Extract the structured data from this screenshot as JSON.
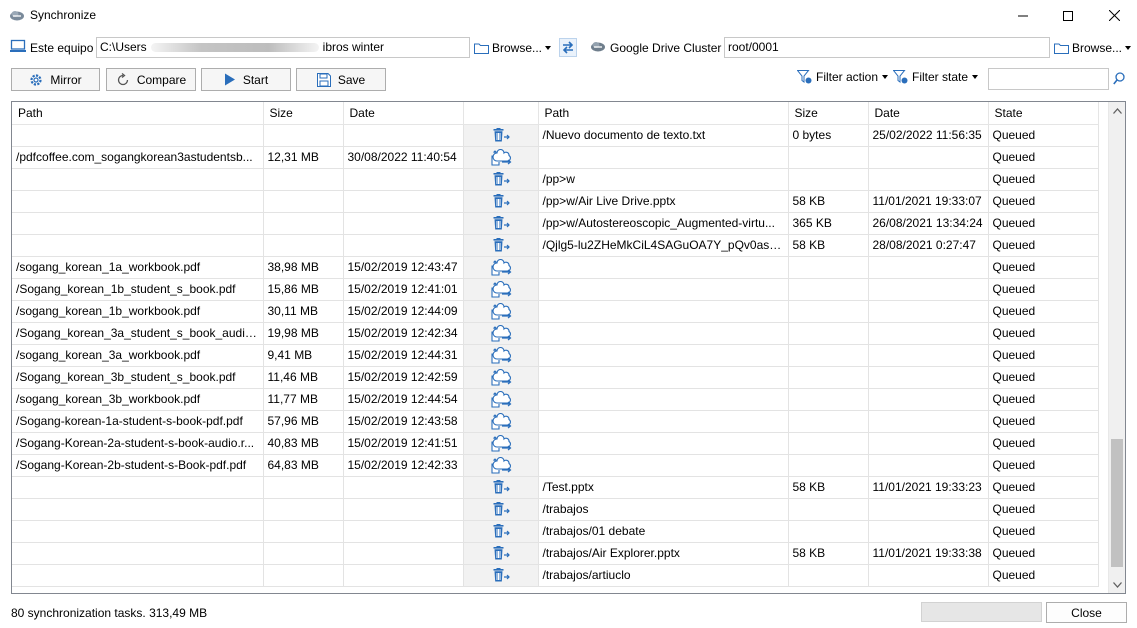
{
  "window": {
    "title": "Synchronize"
  },
  "left_location": {
    "label": "Este equipo",
    "path_start": "C:\\Users",
    "path_end": "ibros winter",
    "browse": "Browse..."
  },
  "right_location": {
    "label": "Google Drive Cluster",
    "path": "root/0001",
    "browse": "Browse..."
  },
  "toolbar": {
    "mirror": "Mirror",
    "compare": "Compare",
    "start": "Start",
    "save": "Save",
    "filter_action": "Filter action",
    "filter_state": "Filter state"
  },
  "columns": {
    "left_path": "Path",
    "left_size": "Size",
    "left_date": "Date",
    "right_path": "Path",
    "right_size": "Size",
    "right_date": "Date",
    "state": "State"
  },
  "rows": [
    {
      "lp": "",
      "ls": "",
      "ld": "",
      "act": "delete",
      "rp": "/Nuevo documento de texto.txt",
      "rs": "0 bytes",
      "rd": "25/02/2022 11:56:35",
      "st": "Queued"
    },
    {
      "lp": "/pdfcoffee.com_sogangkorean3astudentsb...",
      "ls": "12,31 MB",
      "ld": "30/08/2022 11:40:54",
      "act": "upload",
      "rp": "",
      "rs": "",
      "rd": "",
      "st": "Queued"
    },
    {
      "lp": "",
      "ls": "",
      "ld": "",
      "act": "delete",
      "rp": "/pp>w",
      "rs": "",
      "rd": "",
      "st": "Queued"
    },
    {
      "lp": "",
      "ls": "",
      "ld": "",
      "act": "delete",
      "rp": "/pp>w/Air Live Drive.pptx",
      "rs": "58 KB",
      "rd": "11/01/2021 19:33:07",
      "st": "Queued"
    },
    {
      "lp": "",
      "ls": "",
      "ld": "",
      "act": "delete",
      "rp": "/pp>w/Autostereoscopic_Augmented-virtu...",
      "rs": "365 KB",
      "rd": "26/08/2021 13:34:24",
      "st": "Queued"
    },
    {
      "lp": "",
      "ls": "",
      "ld": "",
      "act": "delete",
      "rp": "/Qjlg5-lu2ZHeMkCiL4SAGuOA7Y_pQv0asau...",
      "rs": "58 KB",
      "rd": "28/08/2021 0:27:47",
      "st": "Queued"
    },
    {
      "lp": "/sogang_korean_1a_workbook.pdf",
      "ls": "38,98 MB",
      "ld": "15/02/2019 12:43:47",
      "act": "upload",
      "rp": "",
      "rs": "",
      "rd": "",
      "st": "Queued"
    },
    {
      "lp": "/Sogang_korean_1b_student_s_book.pdf",
      "ls": "15,86 MB",
      "ld": "15/02/2019 12:41:01",
      "act": "upload",
      "rp": "",
      "rs": "",
      "rd": "",
      "st": "Queued"
    },
    {
      "lp": "/sogang_korean_1b_workbook.pdf",
      "ls": "30,11 MB",
      "ld": "15/02/2019 12:44:09",
      "act": "upload",
      "rp": "",
      "rs": "",
      "rd": "",
      "st": "Queued"
    },
    {
      "lp": "/Sogang_korean_3a_student_s_book_audio.z...",
      "ls": "19,98 MB",
      "ld": "15/02/2019 12:42:34",
      "act": "upload",
      "rp": "",
      "rs": "",
      "rd": "",
      "st": "Queued"
    },
    {
      "lp": "/sogang_korean_3a_workbook.pdf",
      "ls": "9,41 MB",
      "ld": "15/02/2019 12:44:31",
      "act": "upload",
      "rp": "",
      "rs": "",
      "rd": "",
      "st": "Queued"
    },
    {
      "lp": "/Sogang_korean_3b_student_s_book.pdf",
      "ls": "11,46 MB",
      "ld": "15/02/2019 12:42:59",
      "act": "upload",
      "rp": "",
      "rs": "",
      "rd": "",
      "st": "Queued"
    },
    {
      "lp": "/sogang_korean_3b_workbook.pdf",
      "ls": "11,77 MB",
      "ld": "15/02/2019 12:44:54",
      "act": "upload",
      "rp": "",
      "rs": "",
      "rd": "",
      "st": "Queued"
    },
    {
      "lp": "/Sogang-korean-1a-student-s-book-pdf.pdf",
      "ls": "57,96 MB",
      "ld": "15/02/2019 12:43:58",
      "act": "upload",
      "rp": "",
      "rs": "",
      "rd": "",
      "st": "Queued"
    },
    {
      "lp": "/Sogang-Korean-2a-student-s-book-audio.r...",
      "ls": "40,83 MB",
      "ld": "15/02/2019 12:41:51",
      "act": "upload",
      "rp": "",
      "rs": "",
      "rd": "",
      "st": "Queued"
    },
    {
      "lp": "/Sogang-Korean-2b-student-s-Book-pdf.pdf",
      "ls": "64,83 MB",
      "ld": "15/02/2019 12:42:33",
      "act": "upload",
      "rp": "",
      "rs": "",
      "rd": "",
      "st": "Queued"
    },
    {
      "lp": "",
      "ls": "",
      "ld": "",
      "act": "delete",
      "rp": "/Test.pptx",
      "rs": "58 KB",
      "rd": "11/01/2021 19:33:23",
      "st": "Queued"
    },
    {
      "lp": "",
      "ls": "",
      "ld": "",
      "act": "delete",
      "rp": "/trabajos",
      "rs": "",
      "rd": "",
      "st": "Queued"
    },
    {
      "lp": "",
      "ls": "",
      "ld": "",
      "act": "delete",
      "rp": "/trabajos/01 debate",
      "rs": "",
      "rd": "",
      "st": "Queued"
    },
    {
      "lp": "",
      "ls": "",
      "ld": "",
      "act": "delete",
      "rp": "/trabajos/Air Explorer.pptx",
      "rs": "58 KB",
      "rd": "11/01/2021 19:33:38",
      "st": "Queued"
    },
    {
      "lp": "",
      "ls": "",
      "ld": "",
      "act": "delete",
      "rp": "/trabajos/artiuclo",
      "rs": "",
      "rd": "",
      "st": "Queued"
    }
  ],
  "status": {
    "summary": "80 synchronization tasks. 313,49 MB",
    "close": "Close"
  },
  "colors": {
    "icon_blue": "#2a6ebb",
    "action_col_bg": "#f2f2f2"
  }
}
